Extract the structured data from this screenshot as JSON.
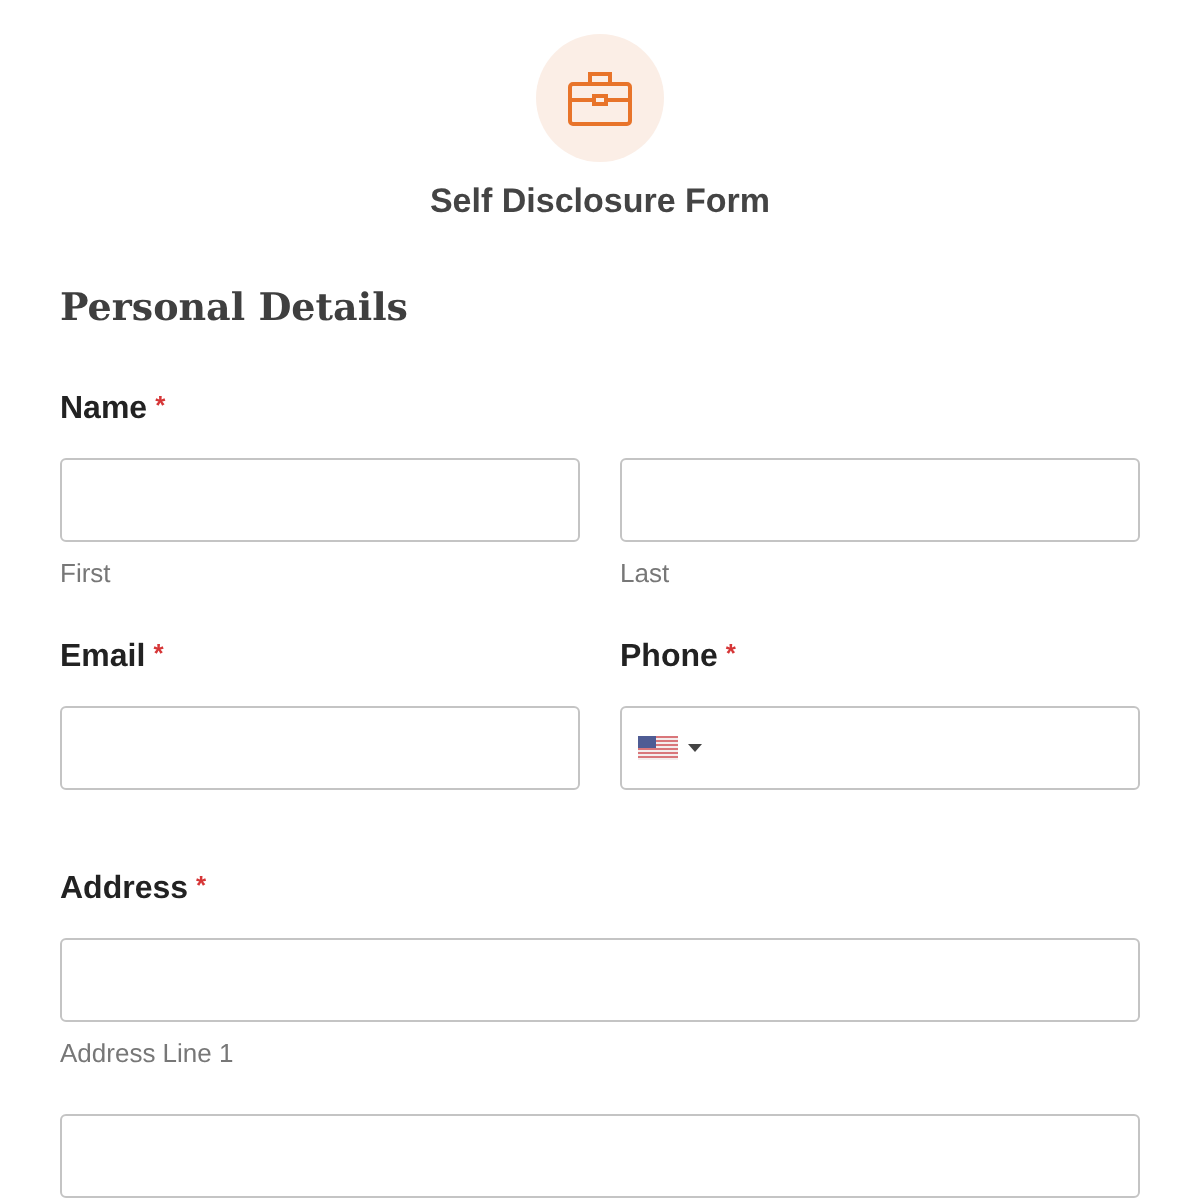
{
  "header": {
    "title": "Self Disclosure Form"
  },
  "section": {
    "title": "Personal Details"
  },
  "rows": [
    {
      "fields": [
        {
          "label": "Name",
          "required_mark": "*",
          "inputs": [
            {
              "kind": "text",
              "sublabel": "First"
            },
            {
              "kind": "text",
              "sublabel": "Last"
            }
          ]
        }
      ]
    },
    {
      "fields": [
        {
          "label": "Email",
          "required_mark": "*",
          "inputs": [
            {
              "kind": "text"
            }
          ]
        },
        {
          "label": "Phone",
          "required_mark": "*",
          "inputs": [
            {
              "kind": "phone"
            }
          ]
        }
      ]
    },
    {
      "fields": [
        {
          "label": "Address",
          "required_mark": "*",
          "inputs": [
            {
              "kind": "text",
              "sublabel": "Address Line 1"
            },
            {
              "kind": "text"
            }
          ]
        }
      ]
    }
  ]
}
